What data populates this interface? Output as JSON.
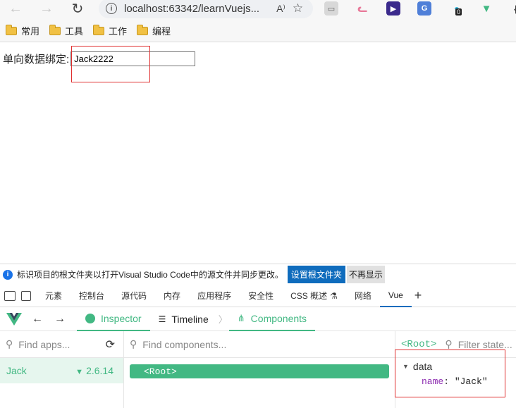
{
  "browser": {
    "url": "localhost:63342/learnVuejs...",
    "bookmarks": [
      "常用",
      "工具",
      "工作",
      "编程"
    ],
    "extension_badge": "0"
  },
  "page": {
    "label": "单向数据绑定:",
    "input_value": "Jack2222"
  },
  "infobar": {
    "message": "标识项目的根文件夹以打开Visual Studio Code中的源文件并同步更改。",
    "primary_button": "设置根文件夹",
    "secondary_button": "不再显示"
  },
  "devtools": {
    "tabs": [
      "元素",
      "控制台",
      "源代码",
      "内存",
      "应用程序",
      "安全性",
      "CSS 概述",
      "网络",
      "Vue"
    ],
    "active_tab": "Vue",
    "add_tab": "+"
  },
  "vue": {
    "tabs": [
      "Inspector",
      "Timeline",
      "Components"
    ],
    "find_apps_placeholder": "Find apps...",
    "find_components_placeholder": "Find components...",
    "filter_state_placeholder": "Filter state...",
    "app_name": "Jack",
    "app_version": "2.6.14",
    "root_component": "<Root>",
    "selected_component": "<Root>",
    "state_section": "data",
    "state_key": "name",
    "state_value": "\"Jack\""
  },
  "colors": {
    "vue_green": "#42b883",
    "highlight_red": "#e03030",
    "primary_blue": "#0f6cbd"
  }
}
